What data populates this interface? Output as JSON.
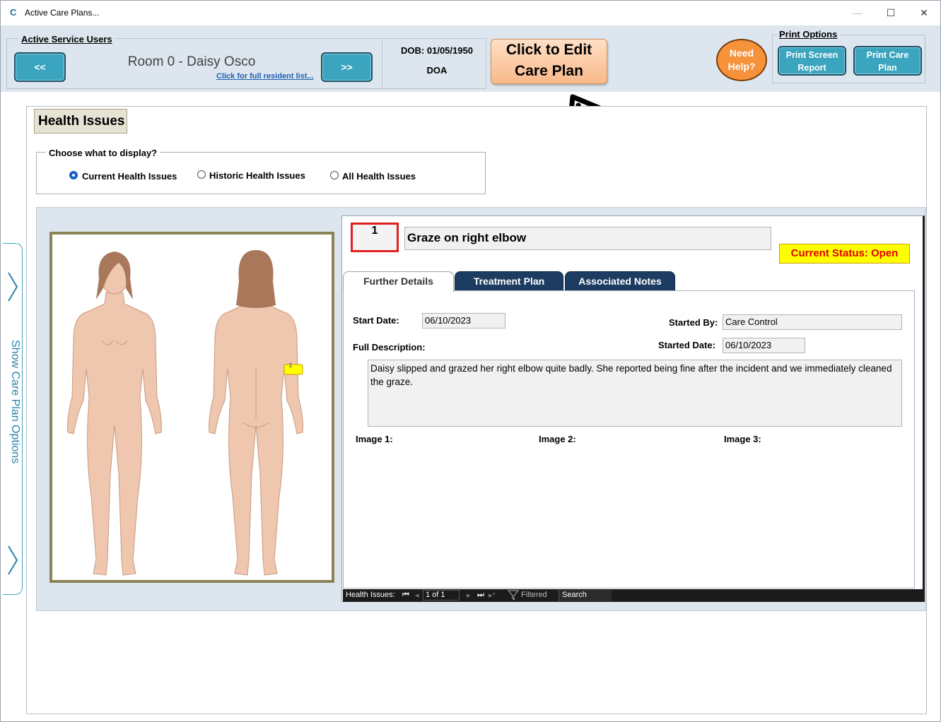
{
  "window": {
    "title": "Active Care Plans...",
    "logo": "C",
    "controls": {
      "minimize": "—",
      "maximize": "☐",
      "close": "✕"
    }
  },
  "header": {
    "service_users_label": "Active Service Users",
    "prev_label": "<<",
    "next_label": ">>",
    "room_resident": "Room 0 - Daisy Osco",
    "resident_list_link": "Click for full resident list...",
    "dob": "DOB: 01/05/1950",
    "doa": "DOA",
    "edit_btn_line1": "Click to Edit",
    "edit_btn_line2": "Care Plan",
    "help_line1": "Need",
    "help_line2": "Help?",
    "print_options_label": "Print Options",
    "print_screen_line1": "Print Screen",
    "print_screen_line2": "Report",
    "print_care_line1": "Print Care",
    "print_care_line2": "Plan"
  },
  "side_panel": {
    "label": "Show Care Plan Options"
  },
  "health_issues": {
    "title": "Health Issues",
    "choose_label": "Choose what to display?",
    "options": [
      {
        "label": "Current Health Issues",
        "selected": true
      },
      {
        "label": "Historic Health Issues",
        "selected": false
      },
      {
        "label": "All Health Issues",
        "selected": false
      }
    ]
  },
  "body_map": {
    "marker_label": "1"
  },
  "issue": {
    "number": "1",
    "title": "Graze on right elbow",
    "status": "Current Status: Open",
    "tabs": [
      "Further Details",
      "Treatment Plan",
      "Associated Notes"
    ],
    "active_tab": "Further Details",
    "start_date_label": "Start Date:",
    "start_date": "06/10/2023",
    "started_by_label": "Started By:",
    "started_by": "Care Control",
    "started_date_label": "Started Date:",
    "started_date": "06/10/2023",
    "full_description_label": "Full Description:",
    "full_description": "Daisy slipped and grazed her right elbow quite badly. She reported being fine after the incident and we immediately cleaned the graze.",
    "image1_label": "Image 1:",
    "image2_label": "Image 2:",
    "image3_label": "Image 3:"
  },
  "record_nav": {
    "label": "Health Issues:",
    "first": "⏮",
    "prev": "◂",
    "position": "1 of 1",
    "next": "▸",
    "last": "⏭",
    "new": "▸*",
    "filter_label": "Filtered",
    "search_label": "Search"
  },
  "colors": {
    "header_bg": "#dde6ee",
    "nav_button": "#3ba4be",
    "edit_button": "#f9b98a",
    "help_button": "#f6923a",
    "dark_tab": "#1c3c62",
    "status_bg": "#ffff00",
    "status_text": "#e00000",
    "issue_number_border": "#e02020",
    "body_frame": "#8c8358",
    "skin": "#efc6ae",
    "hair": "#a9775a"
  },
  "icons": [
    "arrow-annotation-icon",
    "chevron-right-icon",
    "radio-icon",
    "filter-icon"
  ]
}
